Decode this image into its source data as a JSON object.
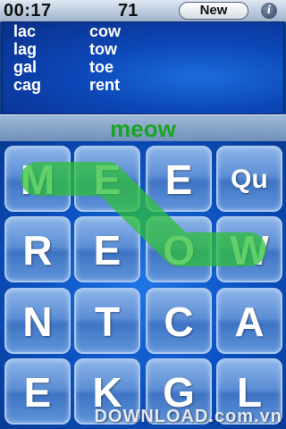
{
  "status": {
    "timer": "00:17",
    "score": "71",
    "new_label": "New",
    "info_icon": "i"
  },
  "found_words": {
    "column1": [
      "lac",
      "lag",
      "gal",
      "cag"
    ],
    "column2": [
      "cow",
      "tow",
      "toe",
      "rent"
    ]
  },
  "current_word": "meow",
  "board": [
    [
      "M",
      "E",
      "E",
      "Qu"
    ],
    [
      "R",
      "E",
      "O",
      "W"
    ],
    [
      "N",
      "T",
      "C",
      "A"
    ],
    [
      "E",
      "K",
      "G",
      "L"
    ]
  ],
  "selected_path": [
    [
      0,
      0
    ],
    [
      0,
      1
    ],
    [
      1,
      2
    ],
    [
      1,
      3
    ]
  ],
  "colors": {
    "current_word": "#19a520",
    "path": "#2fbf3a"
  },
  "watermark": "DOWNLOAD.com.vn"
}
